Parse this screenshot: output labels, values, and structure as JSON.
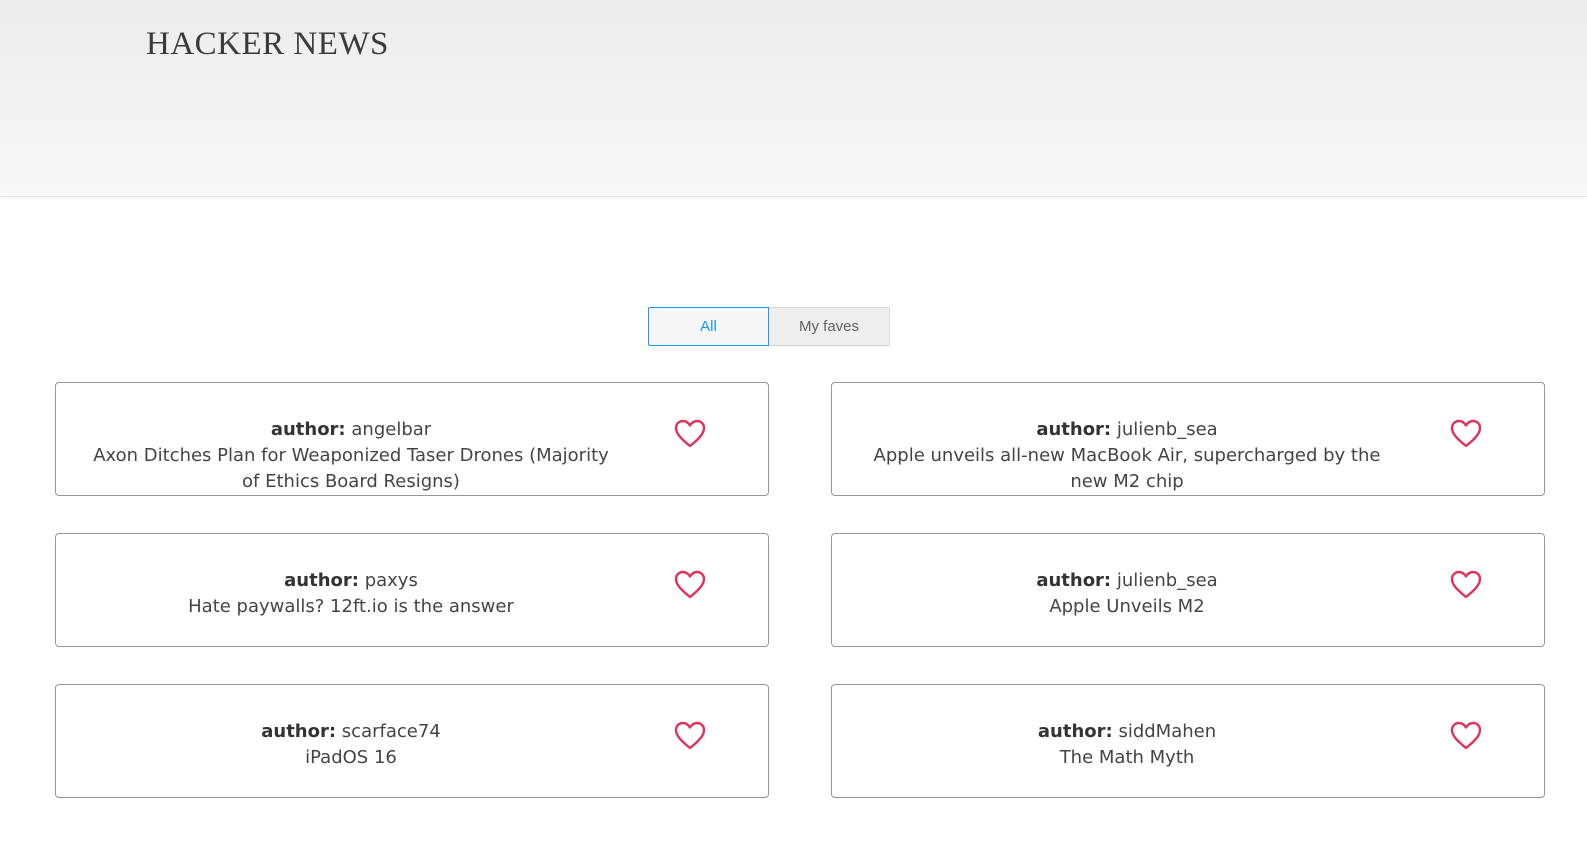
{
  "header": {
    "title": "HACKER NEWS"
  },
  "tabs": [
    {
      "label": "All",
      "active": true
    },
    {
      "label": "My faves",
      "active": false
    }
  ],
  "colors": {
    "accent": "#1797ff",
    "heart": "#e0325a"
  },
  "cards": [
    {
      "author_label": "author:",
      "author": "angelbar",
      "title": "Axon Ditches Plan for Weaponized Taser Drones (Majority of Ethics Board Resigns)",
      "icon": "heart-outline-icon"
    },
    {
      "author_label": "author:",
      "author": "julienb_sea",
      "title": "Apple unveils all-new MacBook Air, supercharged by the new M2 chip",
      "icon": "heart-outline-icon"
    },
    {
      "author_label": "author:",
      "author": "paxys",
      "title": "Hate paywalls? 12ft.io is the answer",
      "icon": "heart-outline-icon"
    },
    {
      "author_label": "author:",
      "author": "julienb_sea",
      "title": "Apple Unveils M2",
      "icon": "heart-outline-icon"
    },
    {
      "author_label": "author:",
      "author": "scarface74",
      "title": "iPadOS 16",
      "icon": "heart-outline-icon"
    },
    {
      "author_label": "author:",
      "author": "siddMahen",
      "title": "The Math Myth",
      "icon": "heart-outline-icon"
    }
  ]
}
